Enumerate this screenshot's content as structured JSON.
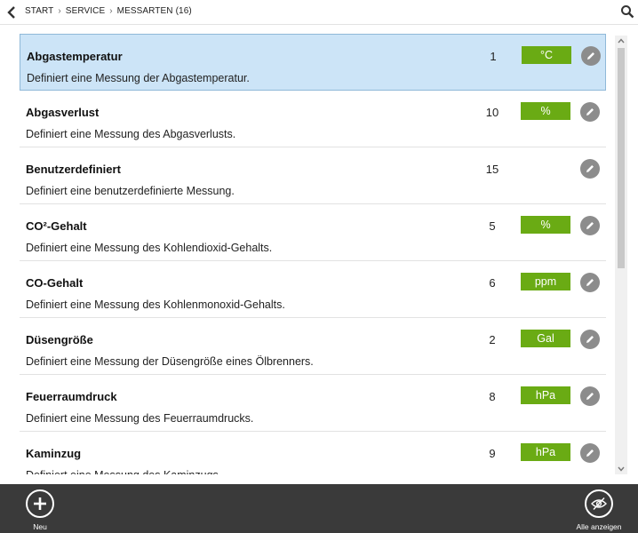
{
  "breadcrumb": {
    "start": "START",
    "service": "SERVICE",
    "current": "MESSARTEN",
    "count": "(16)"
  },
  "items": [
    {
      "title": "Abgastemperatur",
      "desc": "Definiert eine Messung der Abgastemperatur.",
      "number": "1",
      "unit": "°C",
      "selected": true
    },
    {
      "title": "Abgasverlust",
      "desc": "Definiert eine Messung des Abgasverlusts.",
      "number": "10",
      "unit": "%"
    },
    {
      "title": "Benutzerdefiniert",
      "desc": "Definiert eine benutzerdefinierte Messung.",
      "number": "15",
      "unit": ""
    },
    {
      "title": "CO²-Gehalt",
      "desc": "Definiert eine Messung des Kohlendioxid-Gehalts.",
      "number": "5",
      "unit": "%"
    },
    {
      "title": "CO-Gehalt",
      "desc": "Definiert eine Messung des Kohlenmonoxid-Gehalts.",
      "number": "6",
      "unit": "ppm"
    },
    {
      "title": "Düsengröße",
      "desc": "Definiert eine Messung der Düsengröße eines Ölbrenners.",
      "number": "2",
      "unit": "Gal"
    },
    {
      "title": "Feuerraumdruck",
      "desc": "Definiert eine Messung des Feuerraumdrucks.",
      "number": "8",
      "unit": "hPa"
    },
    {
      "title": "Kaminzug",
      "desc": "Definiert eine Messung des Kaminzugs.",
      "number": "9",
      "unit": "hPa"
    }
  ],
  "appbar": {
    "new_label": "Neu",
    "show_all_label": "Alle anzeigen"
  },
  "icons": {
    "back": "chevron-left-icon",
    "search": "search-icon",
    "edit": "pencil-icon",
    "new": "plus-icon",
    "show_all": "eye-slash-icon"
  },
  "colors": {
    "selected_row": "#cce4f7",
    "unit_badge": "#6aab14",
    "edit_button": "#8c8c8c",
    "appbar": "#3a3a3a"
  }
}
